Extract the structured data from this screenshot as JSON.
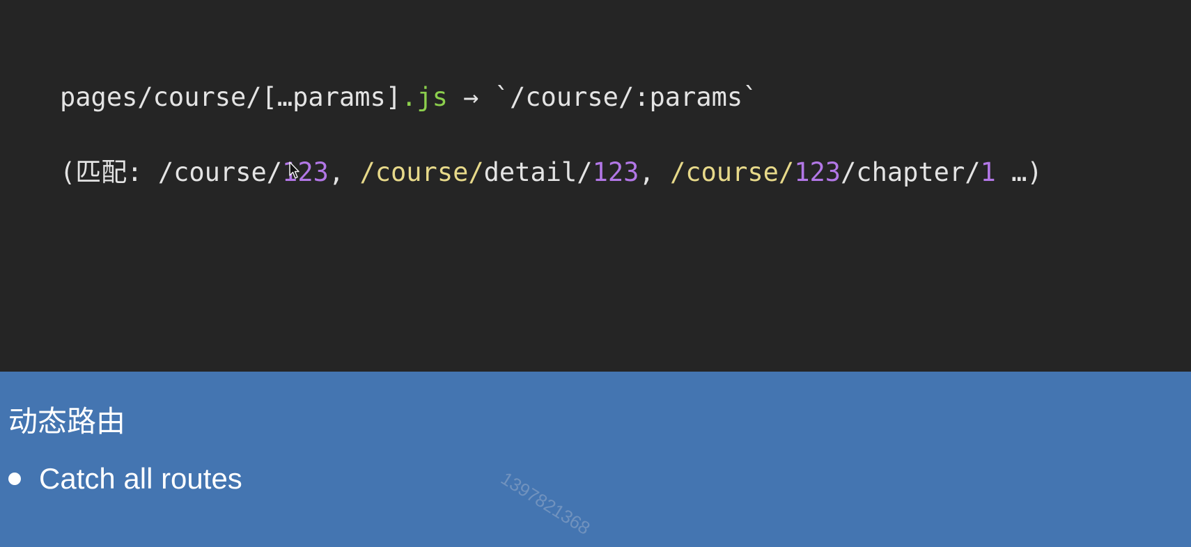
{
  "code": {
    "line1": [
      {
        "text": "pages/course/[…params]",
        "color": "#e4e4e4"
      },
      {
        "text": ".js",
        "color": "#8ccf4d"
      },
      {
        "text": " → `/course/:params`",
        "color": "#e4e4e4"
      }
    ],
    "line2": [
      {
        "text": "(匹配: /course/",
        "color": "#e4e4e4"
      },
      {
        "text": "123",
        "color": "#b277e6"
      },
      {
        "text": ", ",
        "color": "#e4e4e4"
      },
      {
        "text": "/course/",
        "color": "#e7d98a"
      },
      {
        "text": "detail/",
        "color": "#e4e4e4"
      },
      {
        "text": "123",
        "color": "#b277e6"
      },
      {
        "text": ", ",
        "color": "#e4e4e4"
      },
      {
        "text": "/course/",
        "color": "#e7d98a"
      },
      {
        "text": "123",
        "color": "#b277e6"
      },
      {
        "text": "/chapter/",
        "color": "#e4e4e4"
      },
      {
        "text": "1",
        "color": "#b277e6"
      },
      {
        "text": " …)",
        "color": "#e4e4e4"
      }
    ]
  },
  "section": {
    "title": "动态路由",
    "bullet": "Catch all routes"
  },
  "watermark": "13978213​68",
  "colors": {
    "code_background": "#252525",
    "info_background": "#4475b1"
  },
  "icons": {
    "cursor": "mouse-pointer-icon",
    "bullet": "bullet-dot-icon"
  }
}
